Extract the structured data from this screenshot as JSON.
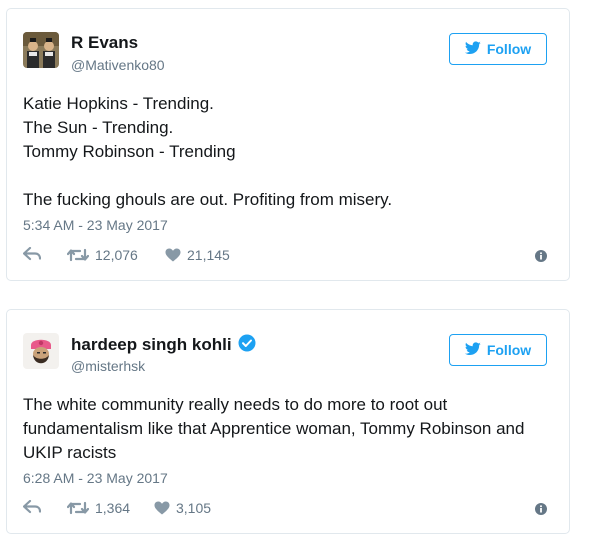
{
  "tweets": [
    {
      "name": "R Evans",
      "handle": "@Mativenko80",
      "verified": false,
      "follow_label": "Follow",
      "lines": [
        "Katie Hopkins - Trending.",
        "The Sun - Trending.",
        "Tommy Robinson - Trending",
        "",
        "The fucking ghouls are out. Profiting from misery."
      ],
      "timestamp": "5:34 AM - 23 May 2017",
      "retweets": "12,076",
      "likes": "21,145"
    },
    {
      "name": "hardeep singh kohli",
      "handle": "@misterhsk",
      "verified": true,
      "follow_label": "Follow",
      "lines": [
        "The white community really needs to do more to root out",
        "fundamentalism like that Apprentice woman, Tommy Robinson and",
        "UKIP racists"
      ],
      "timestamp": "6:28 AM - 23 May 2017",
      "retweets": "1,364",
      "likes": "3,105"
    }
  ],
  "colors": {
    "accent": "#1da1f2",
    "muted": "#657786",
    "border": "#e1e8ed"
  },
  "icons": [
    "twitter-bird-icon",
    "reply-icon",
    "retweet-icon",
    "heart-icon",
    "info-icon",
    "verified-icon"
  ]
}
